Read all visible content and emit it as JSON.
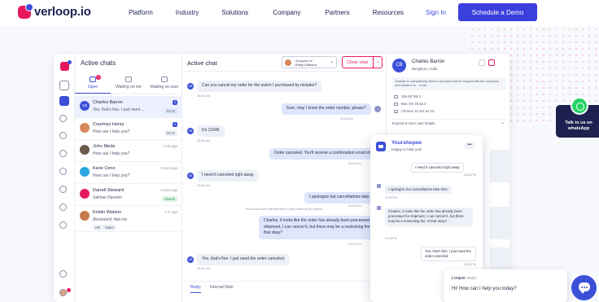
{
  "nav": {
    "brand": "verloop.io",
    "links": [
      "Platform",
      "Industry",
      "Solutions",
      "Company",
      "Partners",
      "Resources"
    ],
    "signin": "Sign In",
    "cta": "Schedule a Demo"
  },
  "active_chats": {
    "title": "Active chats",
    "tabs": [
      {
        "label": "Open",
        "badge": "2"
      },
      {
        "label": "Waiting on me",
        "badge": ""
      },
      {
        "label": "Waiting on user",
        "badge": ""
      }
    ],
    "items": [
      {
        "initials": "CB",
        "name": "Charles Barron",
        "msg": "Yes, that's fine. I just need ...",
        "meta": "2",
        "time": "10:22",
        "avatar_color": "#3b4fd8"
      },
      {
        "initials": "",
        "name": "Courtney Henry",
        "msg": "How can I help you?",
        "meta": "2",
        "time": "10:22",
        "avatar_color": "#d8875a"
      },
      {
        "initials": "",
        "name": "John Meda",
        "msg": "How can I help you?",
        "meta": "1 min ago",
        "time": "",
        "avatar_color": "#6a5a4a"
      },
      {
        "initials": "",
        "name": "Kane Ceno",
        "msg": "How can I help you?",
        "meta": "6 mins ago",
        "time": "",
        "avatar_color": "#29a8e0"
      },
      {
        "initials": "",
        "name": "Darrell Steward",
        "msg": "Salman Kareem",
        "meta": "5 mins ago",
        "tag": "Closed",
        "avatar_color": "#e6195f"
      },
      {
        "initials": "",
        "name": "Kristin Watson",
        "msg": "Absolutely! Ask me",
        "meta": "1 hr ago",
        "tags": [
          "HR",
          "Sales"
        ],
        "avatar_color": "#c77b4b"
      }
    ]
  },
  "active_chat": {
    "title": "Active chat",
    "assigned_label": "Assigned to",
    "assigned_name": "Emily Calhoun",
    "close_label": "Close chat",
    "messages": [
      {
        "dir": "in",
        "text": "Can you cancel my order for the watch I purchased by mistake?",
        "time": "10:24 am"
      },
      {
        "dir": "out",
        "text": "Sure, may I know the order number, please?",
        "time": "10:24 am"
      },
      {
        "dir": "in",
        "text": "It's 12345",
        "time": "10:24 am"
      },
      {
        "dir": "out",
        "text": "Order canceled. You'll receive a confirmation email shortly.",
        "time": "10:24 am"
      },
      {
        "dir": "in",
        "text": "I need it canceled right away.",
        "time": "10:24 am"
      },
      {
        "dir": "out",
        "text": "I apologize but cancellations take time.",
        "time": "10:24 am"
      },
      {
        "dir": "out",
        "text": "Charles, it looks like the order has already been processed for shipment, I can cancel it, but there may be a restocking fee. is that okay?",
        "time": "10:24 am"
      },
      {
        "dir": "in",
        "text": "Yes, that's fine. I just need the order canceled.",
        "time": "10:24 am"
      }
    ],
    "system_note": "Room has been transferred to Emily Calhoun by system",
    "reply_tabs": [
      "Reply",
      "Internal Note"
    ]
  },
  "details": {
    "initials": "CB",
    "name": "Charles Barron",
    "location": "Bengaluru, India",
    "note": "Charles is complaining about a product that he bought with the company and wants it to... more",
    "rows": [
      "106.48.78k.3",
      "Mac OS 29.32.4",
      "Chrome 14.4x2.52.43"
    ],
    "expand": "Expand 6 more user details"
  },
  "widget": {
    "name": "Yourshopee",
    "subtitle": "Happy to help you!",
    "more": "•••",
    "messages": [
      {
        "from": "user",
        "text": "I need it canceled right away.",
        "time": "12:28 PM"
      },
      {
        "from": "bot",
        "text": "I apologize but cancellations take time.",
        "time": "12:28 PM"
      },
      {
        "from": "bot",
        "text": "Charles, it looks like the order has already been processed for shipment, I can cancel it, but there may be a restocking fee. is that okay?",
        "time": "12:28 PM"
      },
      {
        "from": "user",
        "text": "Yes, that's fine. I just need the order canceled.",
        "time": "12:28 PM"
      }
    ]
  },
  "looper": {
    "name": "Looper",
    "says": "says",
    "message": "Hi! How can I help you today?"
  },
  "whatsapp": {
    "label": "Talk to us on whatsApp"
  },
  "colors": {
    "brand_blue": "#3b3fdd",
    "brand_pink": "#e6195f",
    "whatsapp": "#25d366"
  }
}
